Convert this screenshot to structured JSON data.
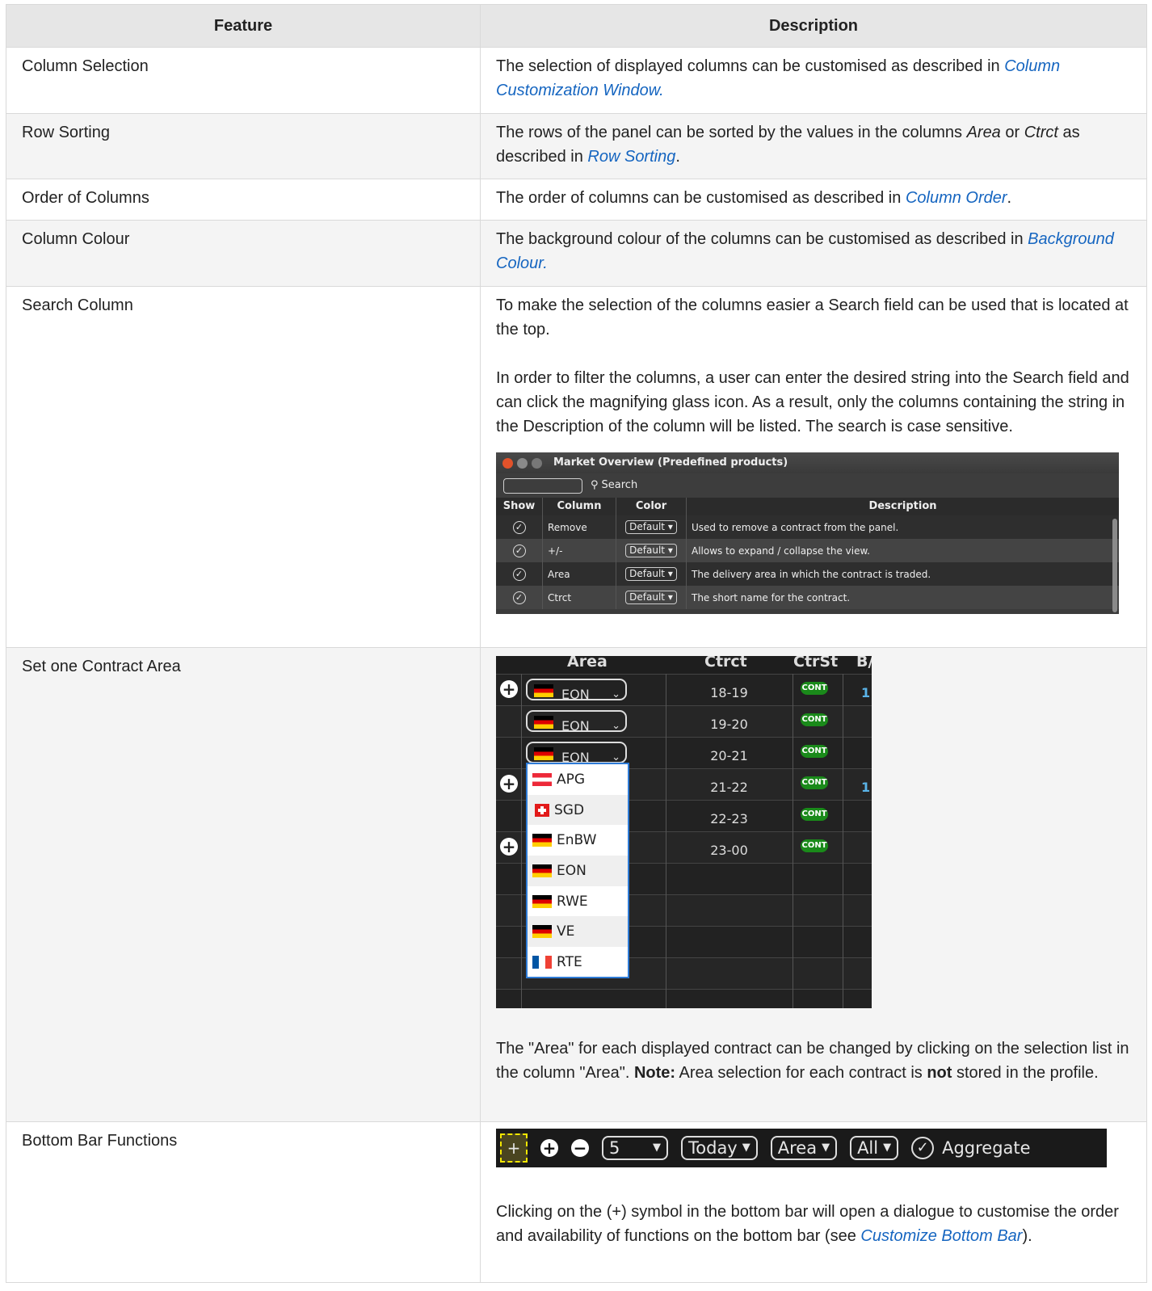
{
  "table": {
    "headers": [
      "Feature",
      "Description"
    ],
    "rows": {
      "column_selection": {
        "feature": "Column Selection",
        "text": "The selection of displayed columns can be customised as described in ",
        "link": "Column Customization Window",
        "after": "."
      },
      "row_sorting": {
        "feature": "Row Sorting",
        "text1": "The rows of the panel can be sorted by the values in the columns ",
        "em1": "Area",
        "text2": " or ",
        "em2": "Ctrct",
        "text3": " as described in ",
        "link": "Row Sorting",
        "after": "."
      },
      "order_of_columns": {
        "feature": "Order of Columns",
        "text": "The order of columns can be customised as described in ",
        "link": "Column Order",
        "after": "."
      },
      "column_colour": {
        "feature": "Column Colour",
        "text": "The background colour of the columns can be customised as described in ",
        "link": "Background Colour",
        "after": "."
      },
      "search_column": {
        "feature": "Search Column",
        "p1": "To make the selection of the columns easier a Search field can be used that is located at the top.",
        "p2": "In order to filter the columns, a user can enter the desired string into the Search field and can click the magnifying glass icon. As a result, only the columns containing the string in the Description of the column will be listed. The search is case sensitive."
      },
      "set_contract_area": {
        "feature": "Set one Contract Area",
        "text1": "The \"Area\" for each displayed contract can be changed by clicking on the selection list in the column \"Area\". ",
        "note": "Note:",
        "text2": " Area selection for each contract is ",
        "not": "not",
        "text3": " stored in the profile."
      },
      "bottom_bar": {
        "feature": "Bottom Bar Functions",
        "text": "Clicking on the (+) symbol in the bottom bar will open a dialogue to customise the order and availability of functions on the bottom bar (see ",
        "link": "Customize Bottom Bar",
        "after": ")."
      }
    }
  },
  "market_overview": {
    "title": "Market Overview (Predefined products)",
    "search_label": "Search",
    "headers": [
      "Show",
      "Column",
      "Color",
      "Description"
    ],
    "rows": [
      {
        "column": "Remove",
        "color": "Default",
        "description": "Used to remove a contract from the panel."
      },
      {
        "column": "+/-",
        "color": "Default",
        "description": "Allows to expand / collapse the view."
      },
      {
        "column": "Area",
        "color": "Default",
        "description": "The delivery area in which the contract is traded."
      },
      {
        "column": "Ctrct",
        "color": "Default",
        "description": "The short name for the contract."
      }
    ]
  },
  "area_panel": {
    "headers": [
      "Area",
      "Ctrct",
      "CtrSt",
      "B/"
    ],
    "rows": [
      {
        "area": "EON",
        "ctrct": "18-19",
        "status": "CONT",
        "b": "1"
      },
      {
        "area": "EON",
        "ctrct": "19-20",
        "status": "CONT",
        "b": ""
      },
      {
        "area": "EON",
        "ctrct": "20-21",
        "status": "CONT",
        "b": ""
      },
      {
        "area": "",
        "ctrct": "21-22",
        "status": "CONT",
        "b": "1"
      },
      {
        "area": "",
        "ctrct": "22-23",
        "status": "CONT",
        "b": ""
      },
      {
        "area": "",
        "ctrct": "23-00",
        "status": "CONT",
        "b": ""
      }
    ],
    "dropdown": [
      "APG",
      "SGD",
      "EnBW",
      "EON",
      "RWE",
      "VE",
      "RTE"
    ]
  },
  "bottom_bar": {
    "add": "+",
    "count": "5",
    "day": "Today",
    "area": "Area",
    "all": "All",
    "aggregate": "Aggregate"
  },
  "colors": {
    "link": "#1565c0",
    "header_bg": "#e6e6e6",
    "cont_green": "#1a8a1a",
    "dropdown_border": "#2e7bd6"
  }
}
